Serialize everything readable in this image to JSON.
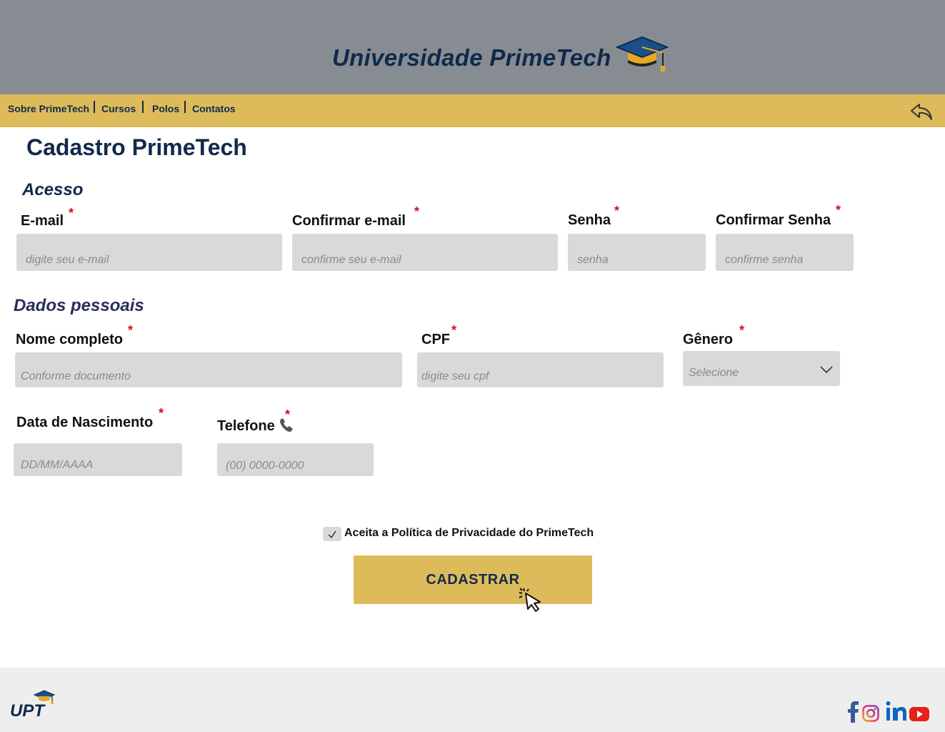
{
  "header": {
    "site_title": "Universidade PrimeTech",
    "cap_icon": "graduation-cap-icon"
  },
  "nav": {
    "items": [
      {
        "label": "Sobre PrimeTech"
      },
      {
        "label": "Cursos"
      },
      {
        "label": "Polos"
      },
      {
        "label": "Contatos"
      }
    ],
    "back_icon": "reply-arrow-icon"
  },
  "page": {
    "title": "Cadastro PrimeTech"
  },
  "acesso": {
    "title": "Acesso",
    "email": {
      "label": "E-mail",
      "required": "*",
      "placeholder": "digite seu e-mail"
    },
    "confirm_email": {
      "label": "Confirmar e-mail",
      "required": "*",
      "placeholder": "confirme seu e-mail"
    },
    "password": {
      "label": "Senha",
      "required": "*",
      "placeholder": "senha"
    },
    "confirm_password": {
      "label": "Confirmar Senha",
      "required": "*",
      "placeholder": "confirme senha"
    }
  },
  "dados": {
    "title": "Dados pessoais",
    "name": {
      "label": "Nome completo",
      "required": "*",
      "placeholder": "Conforme documento"
    },
    "cpf": {
      "label": "CPF",
      "required": "*",
      "placeholder": "digite seu cpf"
    },
    "gender": {
      "label": "Gênero",
      "required": "*",
      "placeholder": "Selecione"
    },
    "birth": {
      "label": "Data de Nascimento",
      "required": "*",
      "placeholder": "DD/MM/AAAA"
    },
    "phone": {
      "label": "Telefone",
      "required": "*",
      "placeholder": "(00) 0000-0000",
      "icon": "phone-icon"
    }
  },
  "privacy": {
    "label": "Aceita a Política de Privacidade do PrimeTech",
    "checked": true
  },
  "submit": {
    "label": "CADASTRAR"
  },
  "footer": {
    "logo_text": "UPT",
    "social": [
      "facebook-icon",
      "instagram-icon",
      "linkedin-icon",
      "youtube-icon"
    ]
  },
  "colors": {
    "header_bg": "#878c93",
    "nav_bg": "#ddbb5b",
    "navy": "#13294b",
    "required": "#d0101c",
    "input_bg": "#d9d9d9",
    "footer_bg": "#eeeeee"
  }
}
